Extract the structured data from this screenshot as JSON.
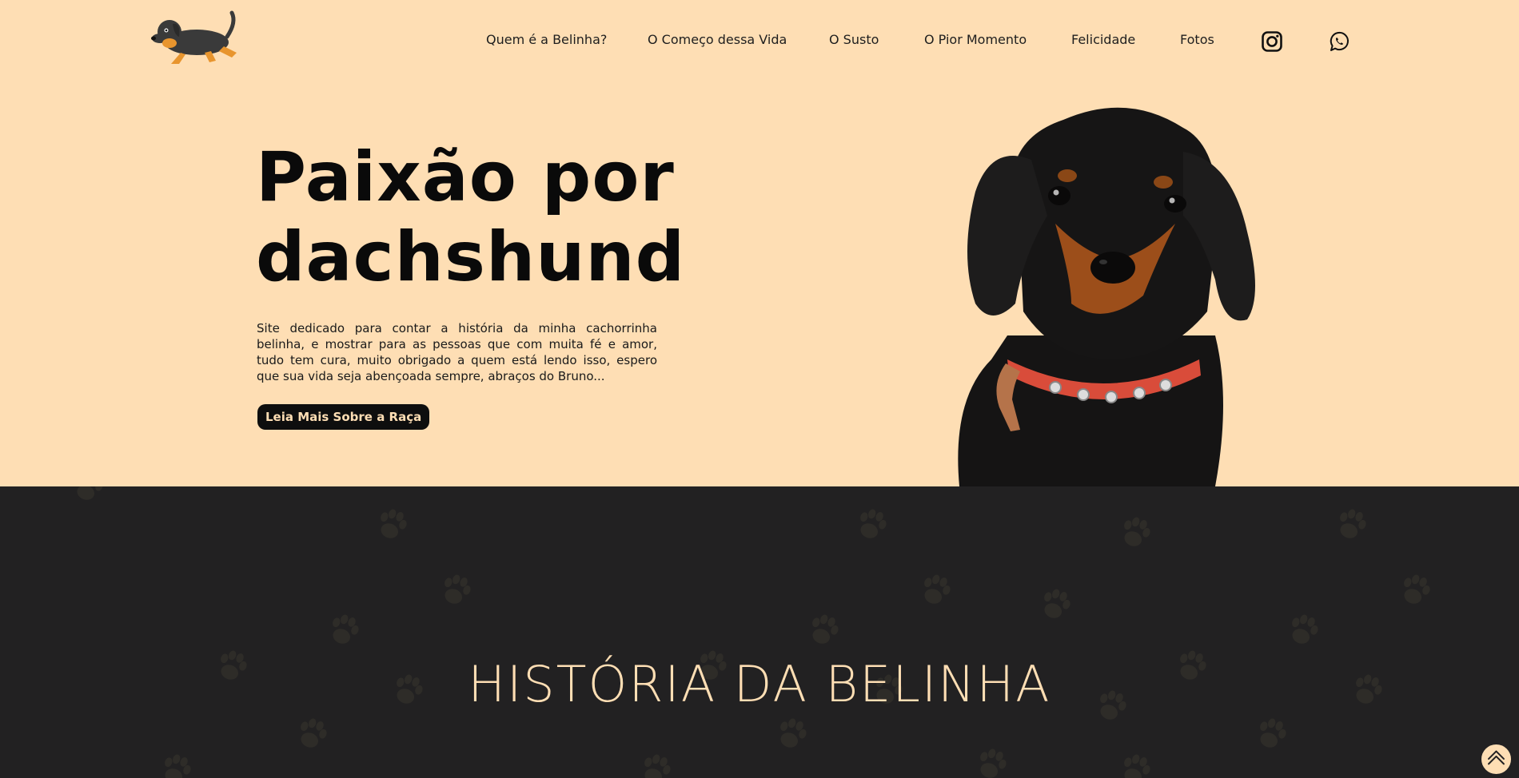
{
  "header": {
    "logo": "dachshund-logo",
    "nav": [
      "Quem é a Belinha?",
      "O Começo dessa Vida",
      "O Susto",
      "O Pior Momento",
      "Felicidade",
      "Fotos"
    ],
    "social_icons": [
      "instagram-icon",
      "whatsapp-icon"
    ]
  },
  "hero": {
    "title_line1": "Paixão por",
    "title_line2": "dachshund",
    "text": "Site dedicado para contar a história da minha cachorrinha belinha, e mostrar para as pessoas que com muita fé e amor, tudo tem cura, muito obrigado a quem está lendo isso, espero que sua vida seja abençoada sempre, abraços do Bruno...",
    "button": "Leia Mais Sobre a Raça"
  },
  "section": {
    "title": "HISTÓRIA DA BELINHA"
  },
  "colors": {
    "hero_bg": "#fedeb4",
    "dark_bg": "#222122",
    "accent": "#fedeb4",
    "paw_print": "#2e2c28"
  }
}
